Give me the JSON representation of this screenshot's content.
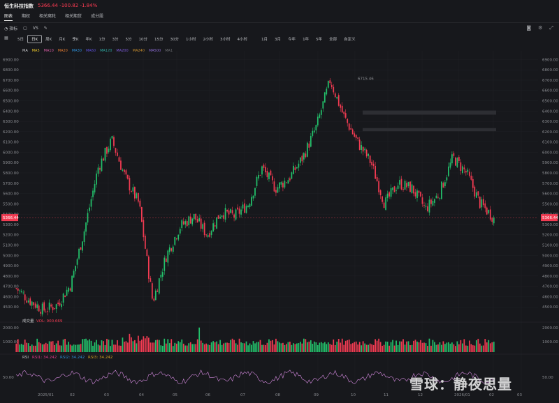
{
  "header": {
    "title": "恒生科技指数",
    "price": "5366.44",
    "change": "-100.82",
    "change_pct": "-1.84%",
    "tabs": [
      "图表",
      "期权",
      "相关窝轮",
      "相关期货",
      "成分股"
    ]
  },
  "toolbar": {
    "indicators_label": "指标",
    "vs_label": "VS",
    "periods": [
      "5日",
      "日K",
      "周K",
      "月K",
      "季K",
      "年K",
      "1分",
      "3分",
      "5分",
      "10分",
      "15分",
      "30分",
      "1小时",
      "2小时",
      "3小时",
      "4小时",
      "1月",
      "3月",
      "今年",
      "1年",
      "5年",
      "全部",
      "自定义"
    ],
    "selected_period": "日K"
  },
  "ma_legend": {
    "label": "MA",
    "items": [
      {
        "name": "MA5",
        "color": "#e6c229"
      },
      {
        "name": "MA10",
        "color": "#d25aa0"
      },
      {
        "name": "MA20",
        "color": "#e0792f"
      },
      {
        "name": "MA30",
        "color": "#2c8fd8"
      },
      {
        "name": "MA60",
        "color": "#5a4ed6"
      },
      {
        "name": "MA120",
        "color": "#2ea7a0"
      },
      {
        "name": "MA200",
        "color": "#7b5ad6"
      },
      {
        "name": "MA240",
        "color": "#c28a2c"
      },
      {
        "name": "MA500",
        "color": "#8a6ad0"
      },
      {
        "name": "MA1",
        "color": "#6a6c70"
      }
    ]
  },
  "chart_data": [
    {
      "type": "candlestick",
      "y_ticks": [
        6900,
        6800,
        6700,
        6600,
        6500,
        6400,
        6300,
        6200,
        6100,
        6000,
        5900,
        5800,
        5700,
        5600,
        5500,
        5400,
        5300,
        5200,
        5100,
        5000,
        4900,
        4800,
        4700,
        4600,
        4500
      ],
      "ylim": [
        4400,
        6950
      ],
      "x_ticks": [
        "2025/01",
        "02",
        "03",
        "04",
        "05",
        "06",
        "07",
        "08",
        "09",
        "10",
        "11",
        "12",
        "2026/01",
        "02",
        "03"
      ],
      "last_price_label": "5366.44",
      "max_label": "6715.46",
      "up_color": "#23c16b",
      "down_color": "#f23b52",
      "trend_points": [
        4680,
        4560,
        4470,
        4520,
        4720,
        5250,
        5850,
        6120,
        5750,
        5500,
        4550,
        5000,
        5280,
        5380,
        5200,
        5420,
        5380,
        5500,
        5850,
        5650,
        5750,
        5950,
        6250,
        6700,
        6350,
        6100,
        5900,
        5500,
        5700,
        5650,
        5450,
        5600,
        5950,
        5800,
        5500,
        5366
      ]
    },
    {
      "type": "bar",
      "title": "成交量",
      "legend": "VOL: 900.669",
      "y_ticks": [
        "2000.00",
        "1000.00"
      ]
    },
    {
      "type": "line",
      "title": "RSI",
      "series": [
        {
          "name": "RSI1: 34.242",
          "color": "#e23a8a"
        },
        {
          "name": "RSI2: 34.242",
          "color": "#2c8fd8"
        },
        {
          "name": "RSI3: 34.242",
          "color": "#d4a020"
        }
      ],
      "y_ticks": [
        "50.00"
      ]
    }
  ],
  "watermark": "雪球：静夜思量"
}
